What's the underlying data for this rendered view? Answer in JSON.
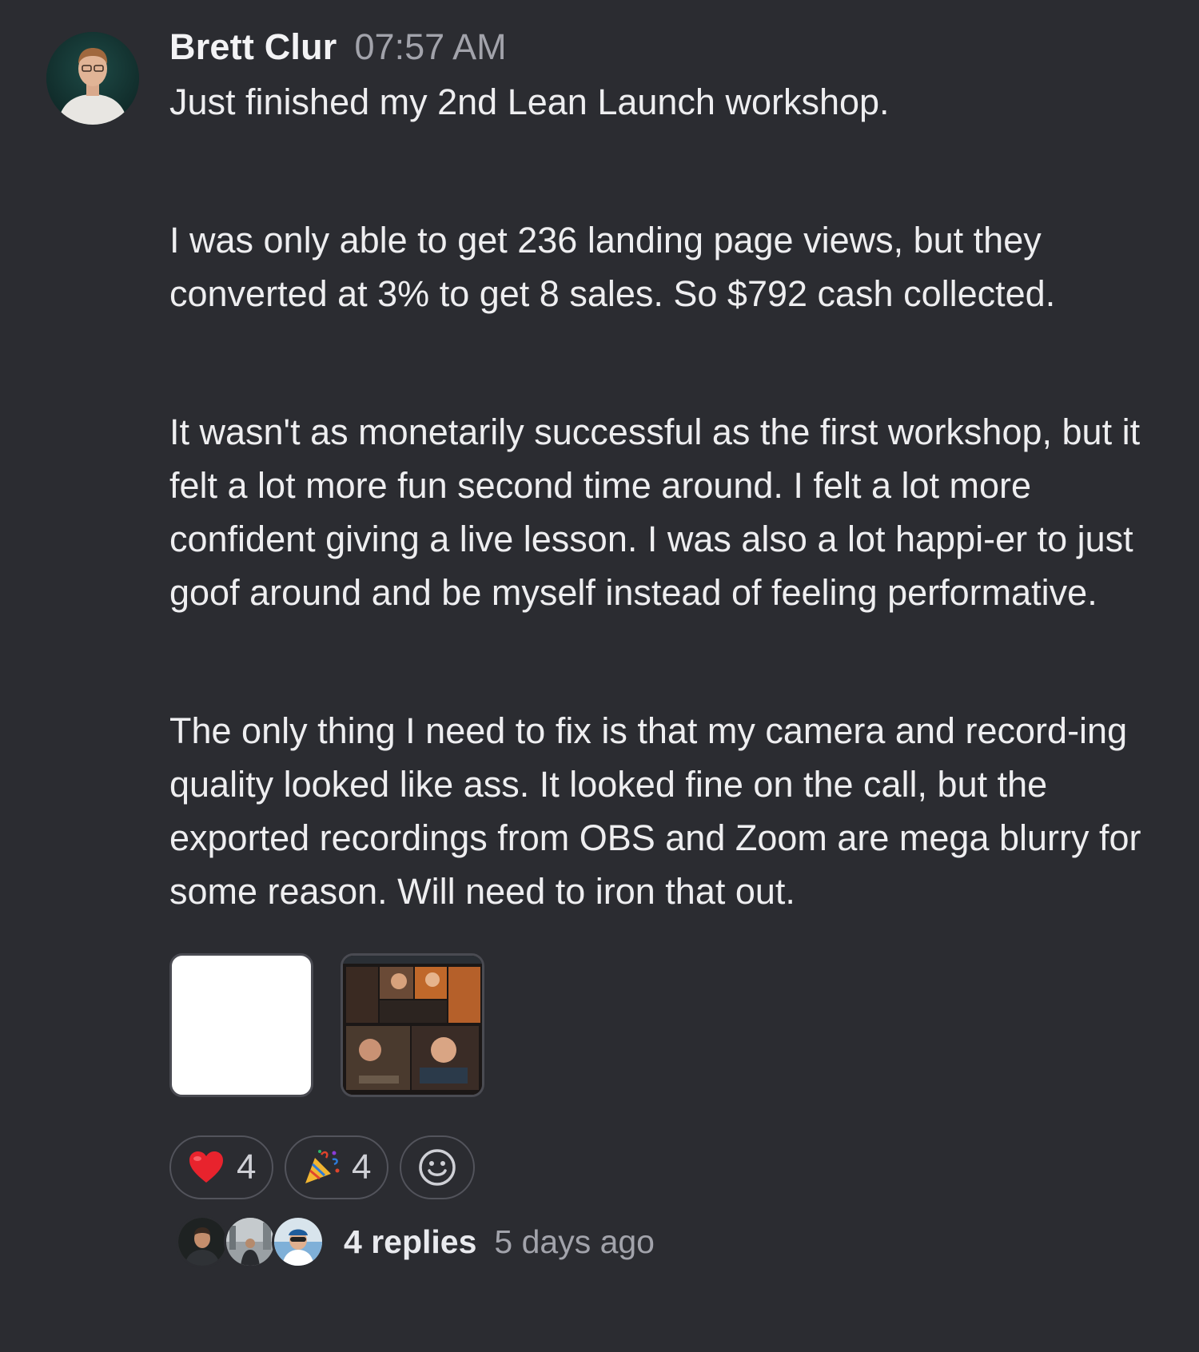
{
  "message": {
    "author": "Brett Clur",
    "time": "07:57 AM",
    "paragraphs": [
      "Just finished my 2nd Lean Launch workshop.",
      "I was only able to get 236 landing page views, but they converted at 3% to get 8 sales. So $792 cash collected.",
      "It wasn't as monetarily successful as the first workshop, but it felt a lot more fun second time around. I felt a lot more confident giving a live lesson. I was also a lot happi-er to just goof around and be myself instead of feeling performative.",
      "The only thing I need to fix is that my camera and record-ing quality looked like ass. It looked fine on the call, but the exported recordings from OBS and Zoom are mega blurry for some reason. Will need to iron that out."
    ],
    "attachments": [
      {
        "kind": "blank-image"
      },
      {
        "kind": "video-call-screenshot"
      }
    ],
    "reactions": [
      {
        "icon": "heart-emoji",
        "count": "4"
      },
      {
        "icon": "party-popper-emoji",
        "count": "4"
      }
    ],
    "add_reaction_icon": "smiley-add-icon",
    "thread": {
      "reply_count": "4 replies",
      "last_reply": "5 days ago",
      "participants": [
        "participant-1",
        "participant-2",
        "participant-3"
      ]
    }
  },
  "colors": {
    "background": "#2b2c31",
    "text": "#eeeef0",
    "muted": "#a2a3ab",
    "pill_border": "#53545c"
  }
}
